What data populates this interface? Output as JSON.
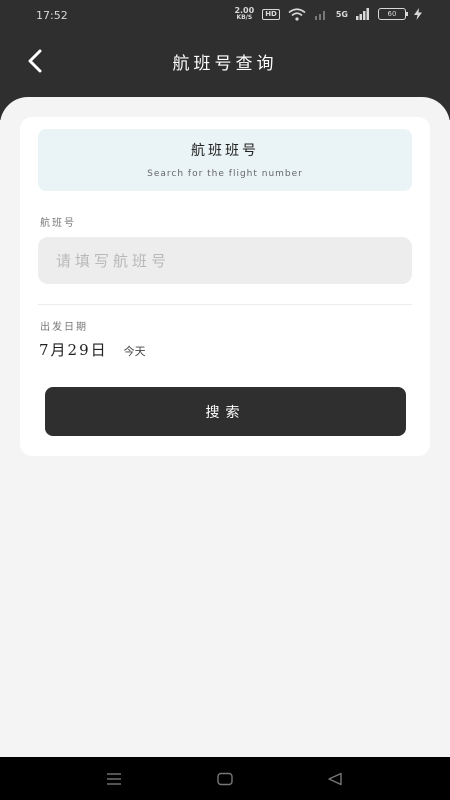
{
  "status_bar": {
    "time": "17:52",
    "net_speed_value": "2.00",
    "net_speed_unit": "KB/S",
    "hd_badge": "HD",
    "network_type": "5G",
    "battery_level": "60"
  },
  "header": {
    "title": "航班号查询",
    "back_icon": "chevron-left-icon"
  },
  "hint": {
    "title": "航班班号",
    "subtitle": "Search for the flight number"
  },
  "flight_field": {
    "label": "航班号",
    "placeholder": "请填写航班号",
    "value": ""
  },
  "date_field": {
    "label": "出发日期",
    "date": "7月29日",
    "day": "今天"
  },
  "search_button": {
    "label": "搜索"
  },
  "nav_bar": {
    "menu_icon": "menu-icon",
    "home_icon": "home-icon",
    "back_icon": "back-triangle-icon"
  },
  "colors": {
    "dark": "#2f2f2f",
    "page_bg": "#f4f4f4",
    "hint_bg": "#eaf4f7",
    "input_bg": "#ededed"
  }
}
